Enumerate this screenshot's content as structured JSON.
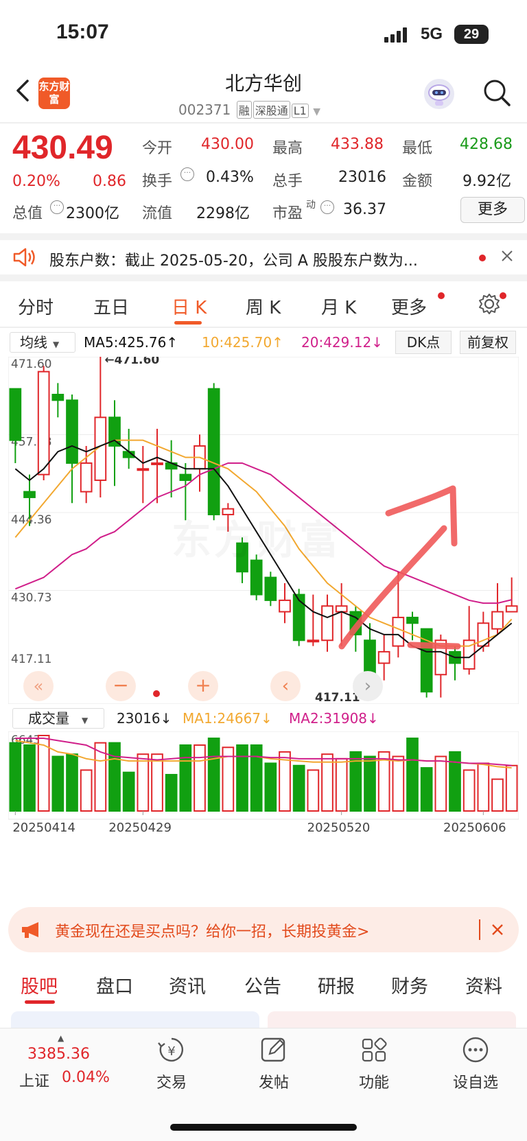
{
  "status": {
    "time": "15:07",
    "network": "5G",
    "battery": "29"
  },
  "header": {
    "logo": "东方财富",
    "title": "北方华创",
    "code": "002371",
    "tags": [
      "融",
      "深股通",
      "L1"
    ]
  },
  "quote": {
    "price": "430.49",
    "pct": "0.20%",
    "chg": "0.86",
    "open_label": "今开",
    "open": "430.00",
    "high_label": "最高",
    "high": "433.88",
    "low_label": "最低",
    "low": "428.68",
    "turn_label": "换手",
    "turn": "0.43%",
    "vol_label": "总手",
    "vol": "23016",
    "amt_label": "金额",
    "amt": "9.92亿",
    "mcap_label": "总值",
    "mcap": "2300亿",
    "float_label": "流值",
    "float": "2298亿",
    "pe_label": "市盈",
    "pe_sup": "动",
    "pe": "36.37",
    "more": "更多"
  },
  "notice": {
    "text": "股东户数：截止 2025-05-20，公司 A 股股东户数为..."
  },
  "chart_tabs": [
    "分时",
    "五日",
    "日 K",
    "周 K",
    "月 K",
    "更多"
  ],
  "active_tab": "日 K",
  "ma_bar": {
    "selector": "均线",
    "ma5": "MA5:425.76↑",
    "ma10": "10:425.70↑",
    "ma20": "20:429.12↓",
    "dk": "DK点",
    "adj": "前复权"
  },
  "vol_bar": {
    "selector": "成交量",
    "vol": "23016↓",
    "ma1": "MA1:24667↓",
    "ma2": "MA2:31908↓",
    "ymax": "66435"
  },
  "chart_data": {
    "type": "candlestick",
    "ylim": [
      417.11,
      471.6
    ],
    "y_ticks": [
      "471.60",
      "457.98",
      "444.36",
      "430.73",
      "417.11"
    ],
    "annotations": [
      "←471.60",
      "417.11→"
    ],
    "x_ticks": [
      "20250414",
      "20250429",
      "20250520",
      "20250606"
    ],
    "colors": {
      "up": "#e0262a",
      "down": "#11a011",
      "ma5": "#111111",
      "ma10": "#f2a830",
      "ma20": "#d01f8a"
    },
    "candles": [
      {
        "o": 466,
        "c": 457,
        "h": 466,
        "l": 453
      },
      {
        "o": 448,
        "c": 447,
        "h": 451,
        "l": 442
      },
      {
        "o": 451,
        "c": 469,
        "h": 470,
        "l": 450
      },
      {
        "o": 465,
        "c": 464,
        "h": 467,
        "l": 461
      },
      {
        "o": 464,
        "c": 453,
        "h": 465,
        "l": 446
      },
      {
        "o": 448,
        "c": 453,
        "h": 456,
        "l": 446
      },
      {
        "o": 450,
        "c": 461,
        "h": 472,
        "l": 447
      },
      {
        "o": 461,
        "c": 456,
        "h": 464,
        "l": 449
      },
      {
        "o": 455,
        "c": 454,
        "h": 459,
        "l": 452
      },
      {
        "o": 452,
        "c": 452,
        "h": 456,
        "l": 446
      },
      {
        "o": 453,
        "c": 453,
        "h": 459,
        "l": 446
      },
      {
        "o": 453,
        "c": 452,
        "h": 457,
        "l": 447
      },
      {
        "o": 451,
        "c": 450,
        "h": 453,
        "l": 443
      },
      {
        "o": 452,
        "c": 456,
        "h": 458,
        "l": 448
      },
      {
        "o": 466,
        "c": 444,
        "h": 467,
        "l": 443
      },
      {
        "o": 444,
        "c": 445,
        "h": 446,
        "l": 441
      },
      {
        "o": 439,
        "c": 434,
        "h": 440,
        "l": 432
      },
      {
        "o": 436,
        "c": 430,
        "h": 437,
        "l": 429
      },
      {
        "o": 433,
        "c": 429,
        "h": 434,
        "l": 428
      },
      {
        "o": 427,
        "c": 429,
        "h": 432,
        "l": 425
      },
      {
        "o": 430,
        "c": 422,
        "h": 431,
        "l": 421
      },
      {
        "o": 422,
        "c": 422,
        "h": 430,
        "l": 421
      },
      {
        "o": 422,
        "c": 428,
        "h": 430,
        "l": 420
      },
      {
        "o": 427,
        "c": 428,
        "h": 432,
        "l": 421
      },
      {
        "o": 427,
        "c": 423,
        "h": 428,
        "l": 420
      },
      {
        "o": 422,
        "c": 416,
        "h": 425,
        "l": 413
      },
      {
        "o": 418,
        "c": 420,
        "h": 423,
        "l": 415
      },
      {
        "o": 421,
        "c": 426,
        "h": 434,
        "l": 419
      },
      {
        "o": 426,
        "c": 425,
        "h": 427,
        "l": 422
      },
      {
        "o": 424,
        "c": 413,
        "h": 424,
        "l": 412
      },
      {
        "o": 416,
        "c": 422,
        "h": 423,
        "l": 412
      },
      {
        "o": 420,
        "c": 418,
        "h": 421,
        "l": 415
      },
      {
        "o": 417,
        "c": 422,
        "h": 428,
        "l": 416
      },
      {
        "o": 421,
        "c": 425,
        "h": 427,
        "l": 420
      },
      {
        "o": 424,
        "c": 427,
        "h": 432,
        "l": 423
      },
      {
        "o": 427,
        "c": 428,
        "h": 433,
        "l": 427
      }
    ],
    "ma5": [
      452,
      450,
      452,
      455,
      456,
      455,
      456,
      457,
      455,
      453,
      454,
      453,
      452,
      452,
      452,
      449,
      445,
      441,
      437,
      433,
      429,
      427,
      426,
      427,
      426,
      424,
      423,
      423,
      421,
      420,
      420,
      419,
      419,
      421,
      423,
      425
    ],
    "ma10": [
      440,
      443,
      446,
      449,
      452,
      454,
      456,
      457,
      457,
      457,
      456,
      455,
      454,
      454,
      453,
      452,
      450,
      448,
      445,
      442,
      438,
      435,
      432,
      430,
      428,
      426,
      425,
      424,
      423,
      422,
      421,
      421,
      421,
      422,
      423,
      425.7
    ],
    "ma20": [
      431,
      432,
      433,
      435,
      437,
      438,
      440,
      441,
      443,
      445,
      447,
      448,
      449,
      451,
      452,
      453,
      453,
      452,
      451,
      449,
      447,
      445,
      443,
      441,
      439,
      437,
      435,
      434,
      433,
      432,
      431,
      430,
      429,
      428.5,
      428.5,
      429.1
    ],
    "volume": [
      60000,
      58000,
      66435,
      48000,
      50000,
      36000,
      60000,
      60000,
      34000,
      50000,
      50000,
      32000,
      58000,
      58000,
      64000,
      56000,
      58000,
      58000,
      42000,
      52000,
      40000,
      36000,
      50000,
      46000,
      52000,
      48000,
      52000,
      48000,
      64000,
      38000,
      48000,
      52000,
      36000,
      42000,
      28000,
      40000
    ],
    "vol_ma1": [
      62000,
      60000,
      58000,
      52000,
      50000,
      46000,
      44000,
      46000,
      44000,
      44000,
      44000,
      44000,
      44000,
      44000,
      46000,
      48000,
      48000,
      48000,
      46000,
      45000,
      44000,
      43000,
      43000,
      43000,
      44000,
      44000,
      45000,
      44000,
      45000,
      44000,
      44000,
      43000,
      42000,
      41000,
      39000,
      38000
    ],
    "vol_ma2": [
      64000,
      64000,
      64000,
      62000,
      60000,
      58000,
      52000,
      48000,
      47000,
      46000,
      45000,
      46000,
      47000,
      47000,
      48000,
      48000,
      48000,
      48000,
      47000,
      47000,
      46000,
      46000,
      46000,
      46000,
      46000,
      46000,
      46000,
      45000,
      45000,
      44000,
      44000,
      43000,
      42000,
      42000,
      41000,
      40000
    ]
  },
  "ad": {
    "text": "黄金现在还是买点吗？给你一招，长期投黄金>"
  },
  "bottom_tabs": [
    "股吧",
    "盘口",
    "资讯",
    "公告",
    "研报",
    "财务",
    "资料"
  ],
  "bottom_nav": {
    "index_value": "3385.36",
    "index_name": "上证",
    "index_pct": "0.04%",
    "items": [
      "交易",
      "发帖",
      "功能",
      "设自选"
    ]
  },
  "watermark": "东方财富"
}
